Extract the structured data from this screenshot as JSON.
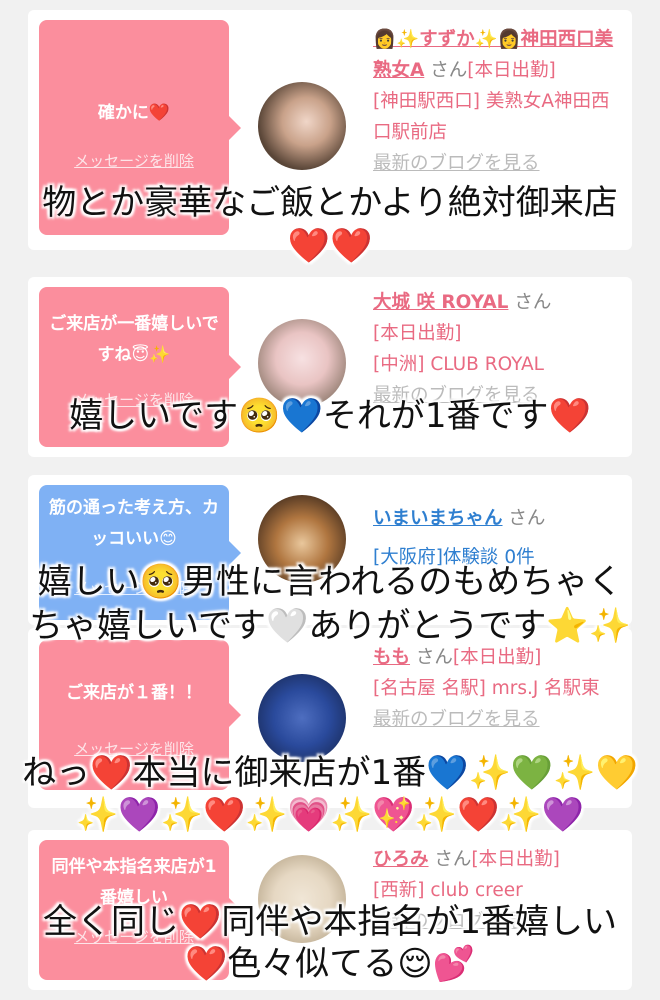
{
  "cards": [
    {
      "message": "確かに❤️",
      "delete_label": "メッセージを削除",
      "name": "👩✨すずか✨👩神田西口美熟女A",
      "san": "さん",
      "status": "[本日出勤]",
      "shop": "[神田駅西口] 美熟女A神田西口駅前店",
      "blog_link": "最新のブログを見る",
      "avatar_colors": [
        "#5a4638",
        "#c9a28a"
      ]
    },
    {
      "message": "ご来店が一番嬉しいですね😇✨",
      "delete_label": "メッセージを削除",
      "name": "大城 咲 ROYAL",
      "san": "さん",
      "status": "[本日出勤]",
      "shop": "[中洲] CLUB ROYAL",
      "blog_link": "最新のブログを見る",
      "avatar_colors": [
        "#bca99a",
        "#f0d5d8"
      ]
    },
    {
      "message": "筋の通った考え方、カッコいい😊",
      "delete_label": "メッセージを削除",
      "name": "いまいまちゃん",
      "san": "さん",
      "status": "[大阪府]体験談 0件",
      "avatar_colors": [
        "#b07640",
        "#3e2a1c"
      ]
    },
    {
      "message": "ご来店が１番！！",
      "delete_label": "メッセージを削除",
      "name": "もも",
      "san": "さん",
      "status": "[本日出勤]",
      "shop": "[名古屋 名駅] mrs.J 名駅東",
      "blog_link": "最新のブログを見る",
      "avatar_colors": [
        "#2a4a9c",
        "#1a2c5c"
      ]
    },
    {
      "message": "同伴や本指名来店が1番嬉しい",
      "delete_label": "メッセージを削除",
      "name": "ひろみ",
      "san": "さん",
      "status": "[本日出勤]",
      "shop": "[西新] club creer",
      "blog_link": "最新のブログを見る",
      "avatar_colors": [
        "#cdbfa5",
        "#e6d8c3"
      ]
    }
  ],
  "captions": [
    "物とか豪華なご飯とかより絶対御来店",
    "❤️❤️",
    "嬉しいです🥺💙それが1番です❤️",
    "嬉しい🥺男性に言われるのもめちゃく",
    "ちゃ嬉しいです🤍ありがとうです⭐✨",
    "ねっ❤️本当に御来店が1番💙✨💚✨💛",
    "✨💜✨❤️✨💗✨💖✨❤️✨💜",
    "全く同じ❤️同伴や本指名が1番嬉しい",
    "❤️色々似てる😌💕"
  ],
  "colors": {
    "bubble_pink": "#fb8e9d",
    "bubble_blue": "#7fb1f4",
    "name_pink": "#e96a82",
    "name_blue": "#2f7fd0"
  }
}
